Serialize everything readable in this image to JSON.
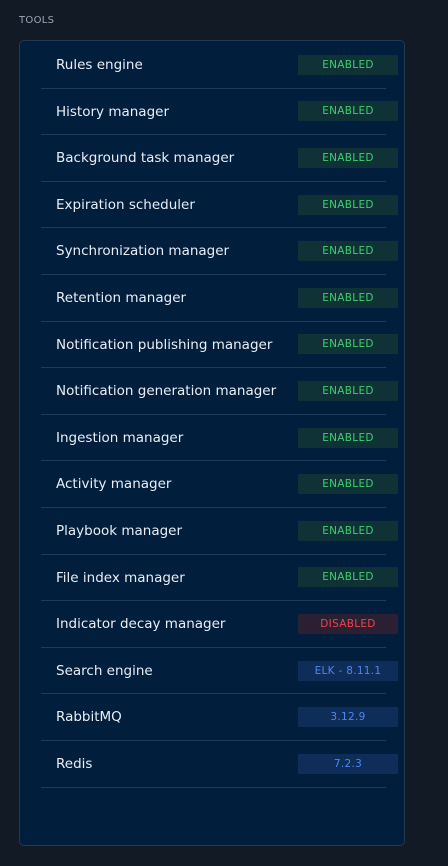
{
  "section": {
    "title": "TOOLS"
  },
  "tools": [
    {
      "label": "Rules engine",
      "status": "ENABLED",
      "kind": "enabled"
    },
    {
      "label": "History manager",
      "status": "ENABLED",
      "kind": "enabled"
    },
    {
      "label": "Background task manager",
      "status": "ENABLED",
      "kind": "enabled"
    },
    {
      "label": "Expiration scheduler",
      "status": "ENABLED",
      "kind": "enabled"
    },
    {
      "label": "Synchronization manager",
      "status": "ENABLED",
      "kind": "enabled"
    },
    {
      "label": "Retention manager",
      "status": "ENABLED",
      "kind": "enabled"
    },
    {
      "label": "Notification publishing manager",
      "status": "ENABLED",
      "kind": "enabled"
    },
    {
      "label": "Notification generation manager",
      "status": "ENABLED",
      "kind": "enabled"
    },
    {
      "label": "Ingestion manager",
      "status": "ENABLED",
      "kind": "enabled"
    },
    {
      "label": "Activity manager",
      "status": "ENABLED",
      "kind": "enabled"
    },
    {
      "label": "Playbook manager",
      "status": "ENABLED",
      "kind": "enabled"
    },
    {
      "label": "File index manager",
      "status": "ENABLED",
      "kind": "enabled"
    },
    {
      "label": "Indicator decay manager",
      "status": "DISABLED",
      "kind": "disabled"
    },
    {
      "label": "Search engine",
      "status": "ELK - 8.11.1",
      "kind": "version"
    },
    {
      "label": "RabbitMQ",
      "status": "3.12.9",
      "kind": "version"
    },
    {
      "label": "Redis",
      "status": "7.2.3",
      "kind": "version"
    }
  ],
  "colors": {
    "page_background": "#111a25",
    "panel_background": "#011e3d",
    "enabled_text": "#3fcf6e",
    "disabled_text": "#f0434c",
    "version_text": "#4f86f0"
  }
}
